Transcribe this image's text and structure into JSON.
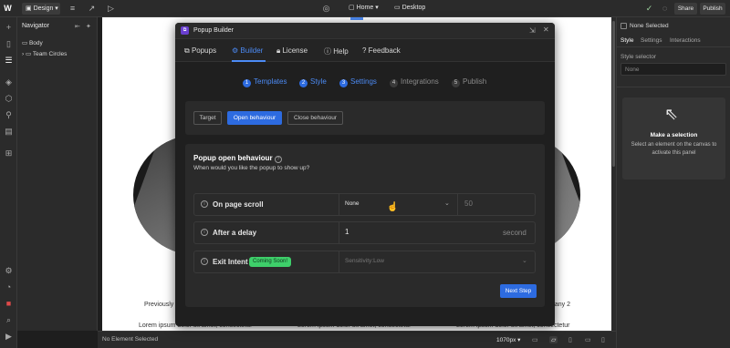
{
  "topbar": {
    "design_label": "Design",
    "page_label": "Home",
    "device_label": "Desktop",
    "share_label": "Share",
    "publish_label": "Publish"
  },
  "navigator": {
    "title": "Navigator",
    "items": [
      {
        "label": "Body"
      },
      {
        "label": "Team Circles"
      }
    ]
  },
  "canvas": {
    "left_caption": "Previously",
    "right_caption": "pany 2",
    "lorem_1": "Lorem ipsum dolor sit amet, consectetur",
    "lorem_2": "Lorem ipsum dolor sit amet, consectetur",
    "lorem_3": "Lorem ipsum dolor sit amet, consectetur"
  },
  "status": {
    "selection": "No Element Selected",
    "breakpoint": "1070px"
  },
  "right_panel": {
    "none_selected": "None Selected",
    "tabs": [
      "Style",
      "Settings",
      "Interactions"
    ],
    "style_selector_label": "Style selector",
    "style_selector_value": "None",
    "empty_title": "Make a selection",
    "empty_desc_1": "Select an element on the canvas to",
    "empty_desc_2": "activate this panel"
  },
  "modal": {
    "title": "Popup Builder",
    "tabs": [
      {
        "label": "Popups",
        "icon": "popups-icon"
      },
      {
        "label": "Builder",
        "icon": "gear-icon"
      },
      {
        "label": "License",
        "icon": "lock-icon"
      },
      {
        "label": "Help",
        "icon": "info-icon"
      },
      {
        "label": "Feedback",
        "icon": "question-icon"
      }
    ],
    "steps": [
      {
        "num": "1",
        "label": "Templates"
      },
      {
        "num": "2",
        "label": "Style"
      },
      {
        "num": "3",
        "label": "Settings"
      },
      {
        "num": "4",
        "label": "Integrations"
      },
      {
        "num": "5",
        "label": "Publish"
      }
    ],
    "subtabs": [
      "Target",
      "Open behaviour",
      "Close behaviour"
    ],
    "section_title": "Popup open behaviour",
    "section_desc": "When would you like the popup to show up?",
    "options": [
      {
        "label": "On page scroll",
        "select_value": "None",
        "value": "50"
      },
      {
        "label": "After a delay",
        "value": "1",
        "unit": "second"
      },
      {
        "label": "Exit Intent",
        "badge": "Coming Soon!",
        "select_value": "Sensitivity:Low"
      }
    ],
    "next_label": "Next Step"
  },
  "colors": {
    "accent": "#2d6be0",
    "badge_green": "#3ecf6a"
  }
}
